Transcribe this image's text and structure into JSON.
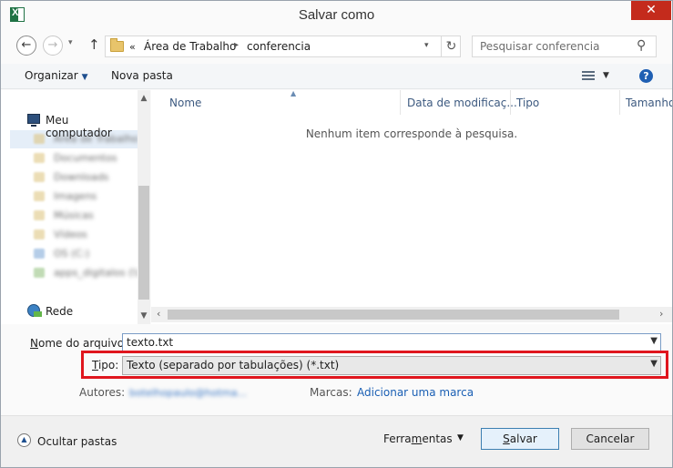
{
  "window": {
    "title": "Salvar como",
    "close_glyph": "✕",
    "app_icon": "excel-icon"
  },
  "nav": {
    "back_glyph": "←",
    "forward_glyph": "→",
    "dropdown_glyph": "▾",
    "up_glyph": "↑",
    "breadcrumb_overflow": "«",
    "breadcrumb": [
      "Área de Trabalho",
      "conferencia"
    ],
    "breadcrumb_separator": "▸",
    "refresh_glyph": "↻",
    "search_placeholder": "Pesquisar conferencia",
    "search_glyph": "⚲"
  },
  "toolbar": {
    "organize_label": "Organizar",
    "new_folder_label": "Nova pasta",
    "help_glyph": "?"
  },
  "sidebar": {
    "computer_label": "Meu computador",
    "blurred_items": [
      "Área de Trabalho",
      "Documentos",
      "Downloads",
      "Imagens",
      "Músicas",
      "Vídeos",
      "OS (C:)",
      "apps_digitalos (\\\\"
    ],
    "network_label": "Rede"
  },
  "filelist": {
    "columns": [
      "Nome",
      "Data de modificaç...",
      "Tipo",
      "Tamanho"
    ],
    "empty_message": "Nenhum item corresponde à pesquisa."
  },
  "form": {
    "filename_label_u": "N",
    "filename_label_rest": "ome do arquivo:",
    "filename_value": "texto.txt",
    "type_label_u": "T",
    "type_label_rest": "ipo:",
    "type_value": "Texto (separado por tabulações) (*.txt)",
    "authors_label": "Autores:",
    "authors_value": "botelhopaulo@hotma...",
    "tags_label": "Marcas:",
    "tags_link": "Adicionar uma marca"
  },
  "footer": {
    "hide_folders_label": "Ocultar pastas",
    "tools_label_pre": "Ferra",
    "tools_label_u": "m",
    "tools_label_post": "entas",
    "save_label_u": "S",
    "save_label_rest": "alvar",
    "cancel_label": "Cancelar"
  },
  "colors": {
    "highlight": "#e0161e",
    "close": "#c42b1c",
    "link": "#1a5fb4"
  }
}
